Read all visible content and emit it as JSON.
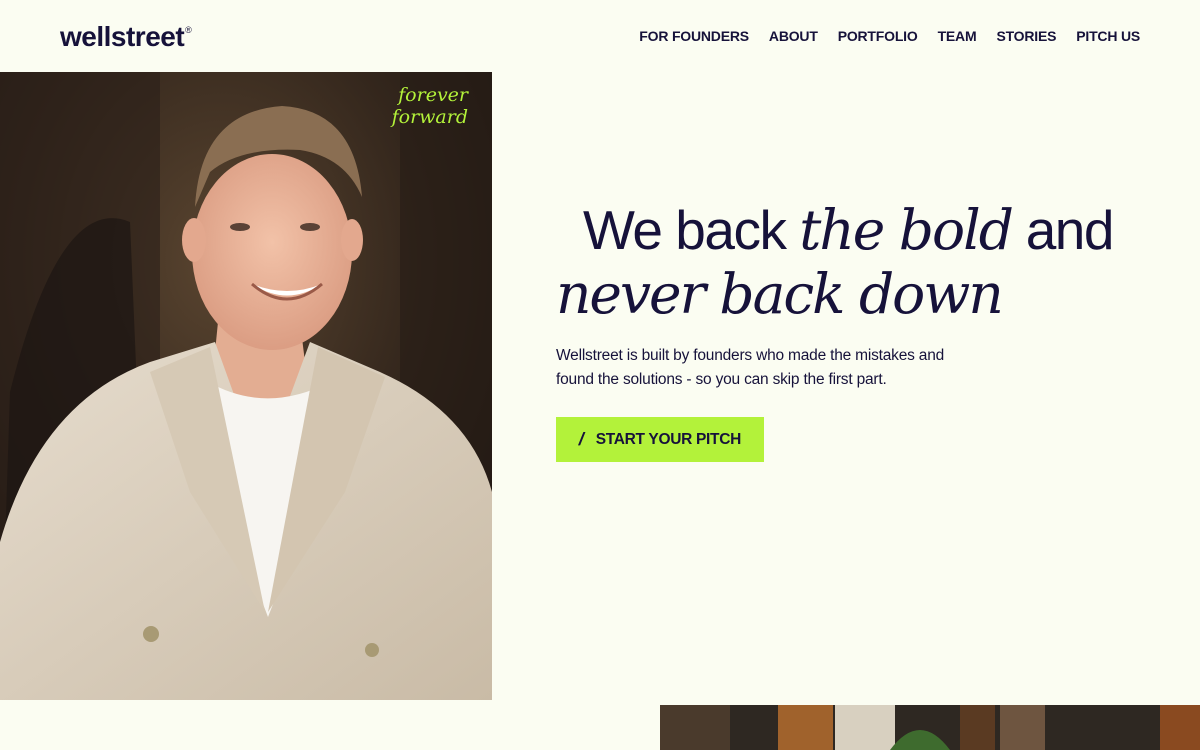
{
  "header": {
    "logo": "wellstreet",
    "logo_mark": "®",
    "nav": [
      {
        "label": "FOR FOUNDERS"
      },
      {
        "label": "ABOUT"
      },
      {
        "label": "PORTFOLIO"
      },
      {
        "label": "TEAM"
      },
      {
        "label": "STORIES"
      },
      {
        "label": "PITCH US"
      }
    ]
  },
  "hero": {
    "tagline": [
      "forever",
      "forward"
    ],
    "headline": {
      "part1": "We back ",
      "part2": "the bold",
      "part3": " and",
      "part4": "never back down"
    },
    "subtext": "Wellstreet is built by founders who made the mistakes and found the solutions - so you can skip the first part.",
    "cta": {
      "icon": "/",
      "label": "START YOUR PITCH"
    }
  },
  "colors": {
    "background": "#fbfdf2",
    "text": "#16123a",
    "accent": "#b3f23a"
  }
}
